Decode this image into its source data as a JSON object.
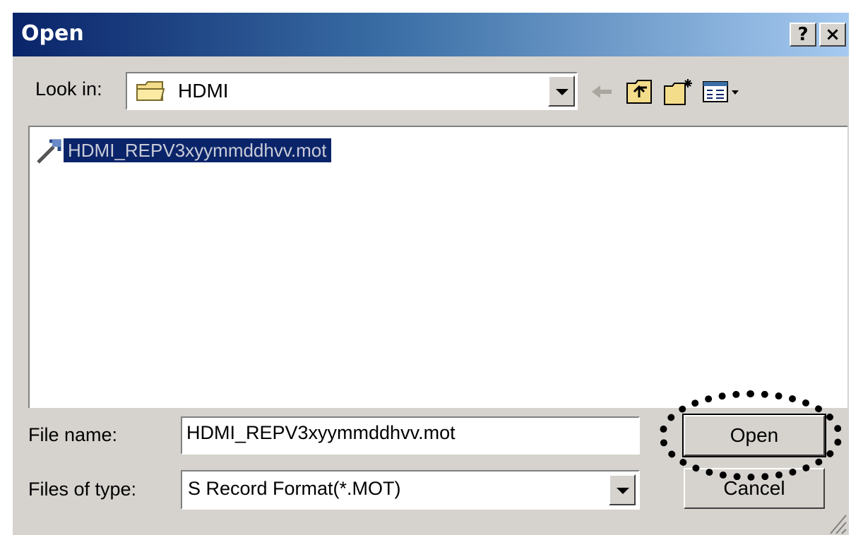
{
  "window": {
    "title": "Open",
    "help_label": "?",
    "close_label": "×"
  },
  "look_in": {
    "label": "Look in:",
    "value": "HDMI"
  },
  "files": [
    {
      "name": "HDMI_REPV3xyymmddhvv.mot",
      "selected": true
    }
  ],
  "file_name": {
    "label": "File name:",
    "value": "HDMI_REPV3xyymmddhvv.mot"
  },
  "files_of_type": {
    "label": "Files of type:",
    "value": "S Record Format(*.MOT)"
  },
  "buttons": {
    "open": "Open",
    "cancel": "Cancel"
  },
  "colors": {
    "title_bar": "#0a246a",
    "face": "#d6d3ce",
    "selection": "#0a246a"
  },
  "icons": [
    "folder-icon",
    "chevron-down-icon",
    "back-arrow-icon",
    "up-folder-icon",
    "new-folder-icon",
    "view-menu-icon",
    "file-icon",
    "resize-grip-icon"
  ]
}
